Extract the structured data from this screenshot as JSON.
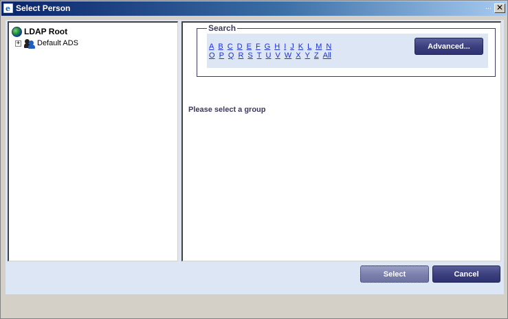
{
  "window": {
    "title": "Select Person",
    "more_glyph": "...",
    "close_glyph": "✕"
  },
  "tree": {
    "root_label": "LDAP Root",
    "expander_glyph": "+",
    "child_label": "Default ADS"
  },
  "search": {
    "legend": "Search",
    "row1": [
      "A",
      "B",
      "C",
      "D",
      "E",
      "F",
      "G",
      "H",
      "I",
      "J",
      "K",
      "L",
      "M",
      "N"
    ],
    "row2": [
      "O",
      "P",
      "Q",
      "R",
      "S",
      "T",
      "U",
      "V",
      "W",
      "X",
      "Y",
      "Z",
      "All"
    ],
    "advanced_label": "Advanced..."
  },
  "message": "Please select a group",
  "buttons": {
    "select_label": "Select",
    "cancel_label": "Cancel"
  },
  "colors": {
    "accent": "#3c4080",
    "link": "#1a2fd6",
    "panel_bg": "#dde6f5"
  }
}
